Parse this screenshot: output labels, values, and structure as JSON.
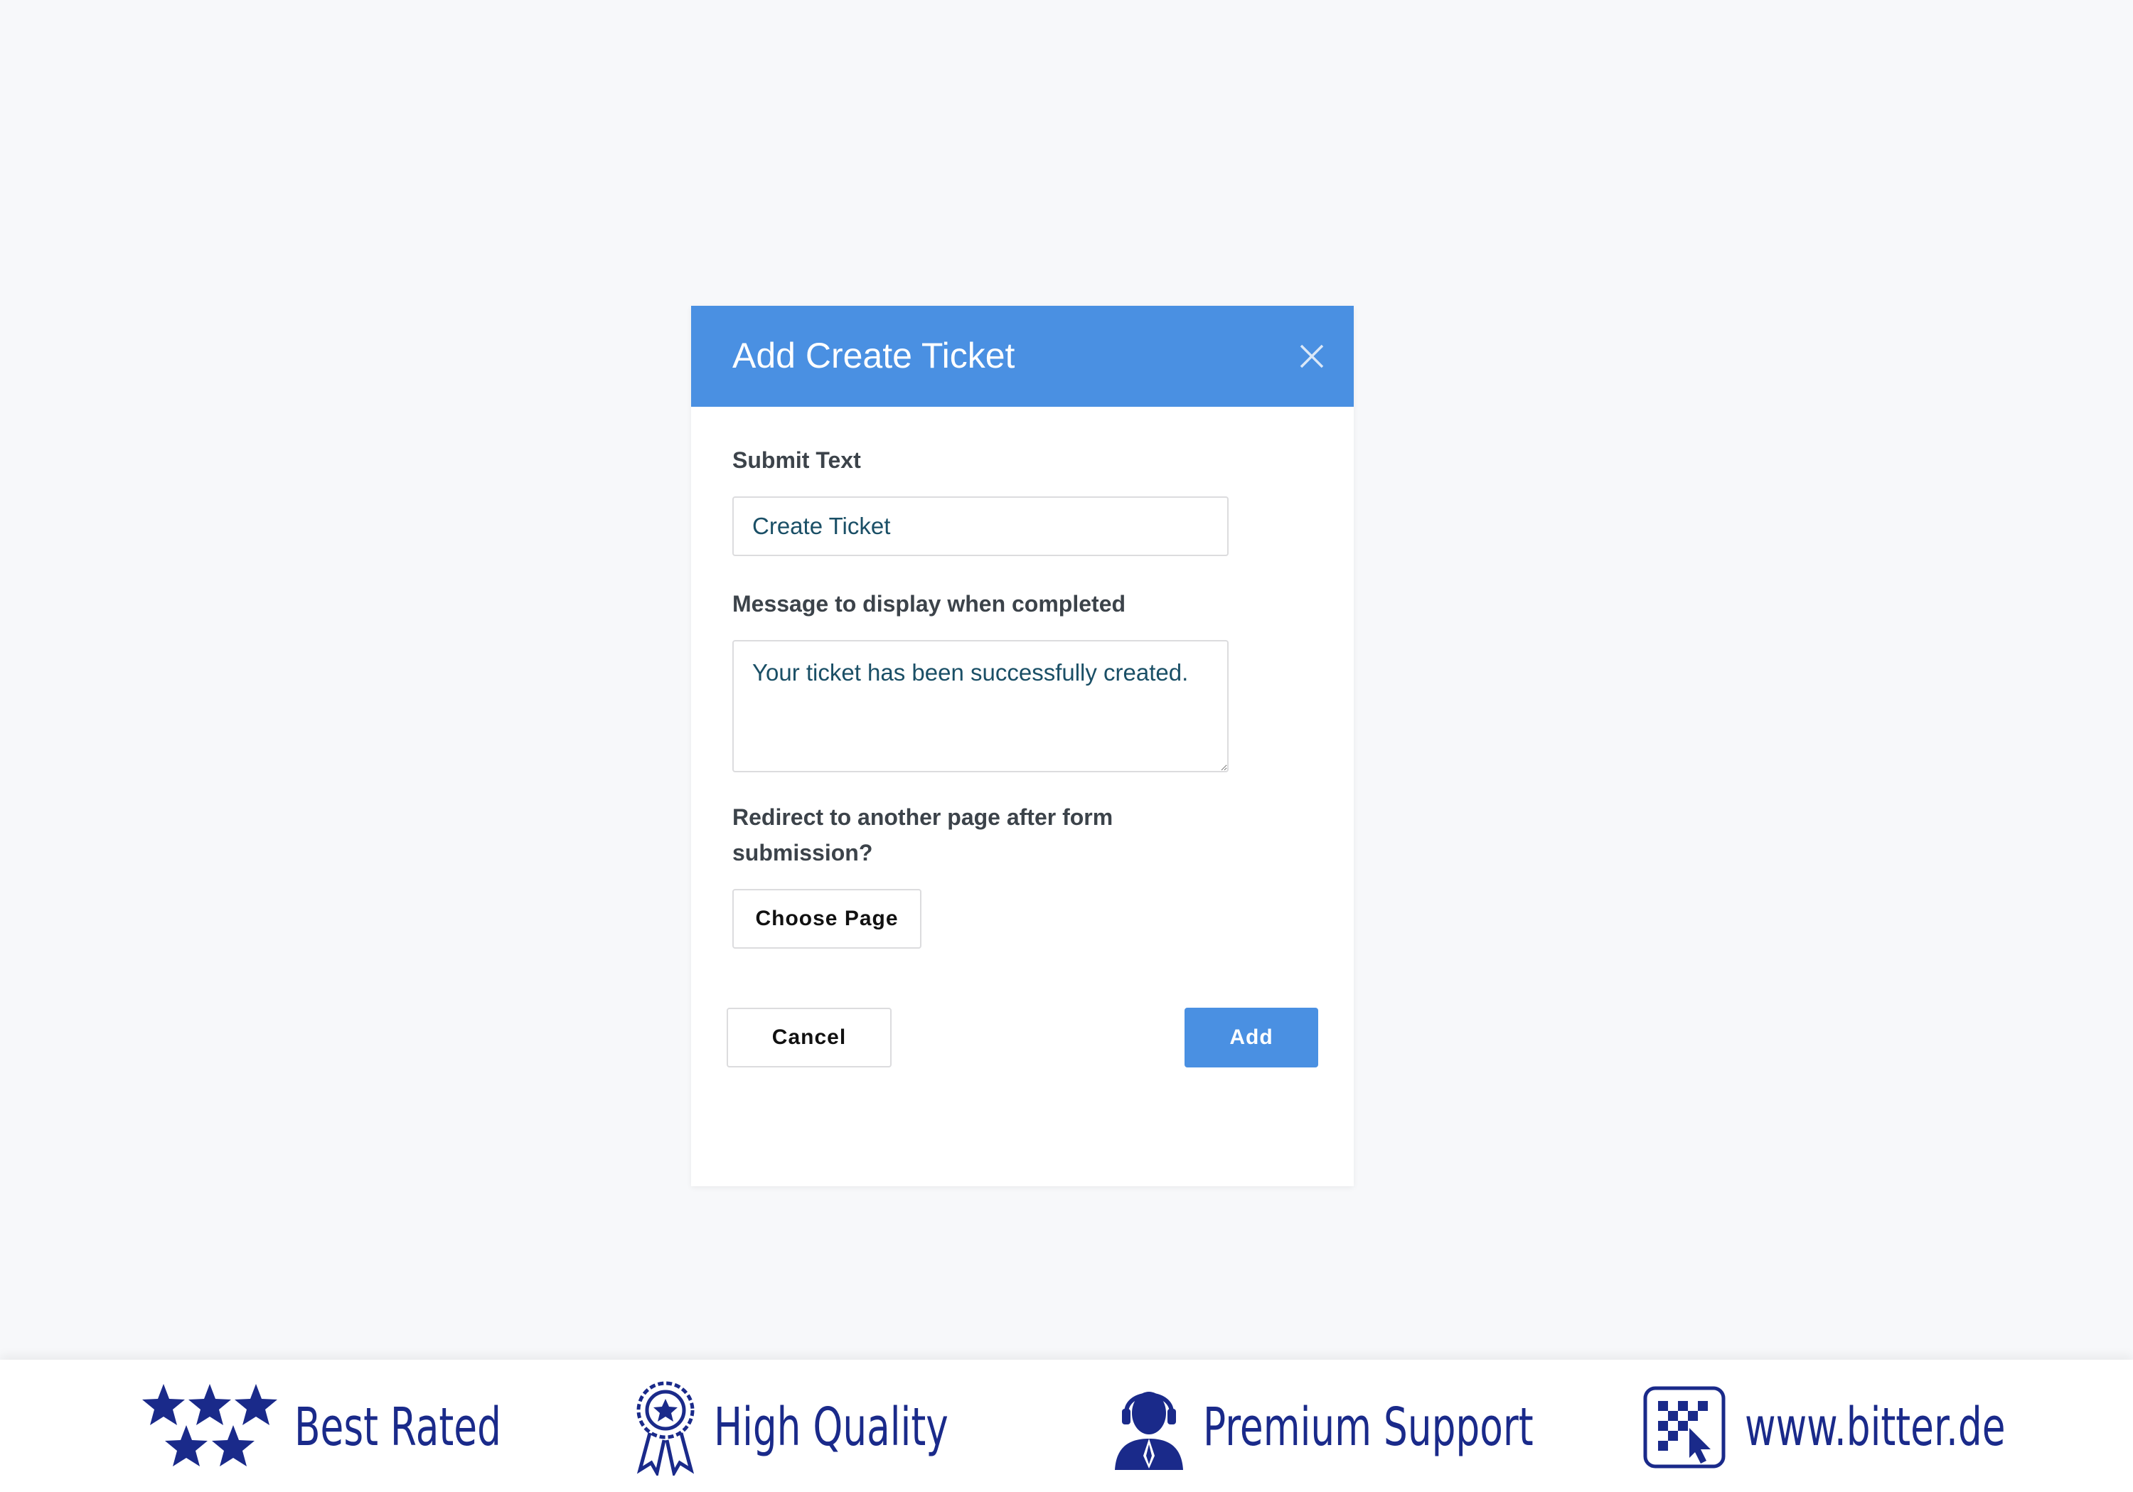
{
  "modal": {
    "title": "Add Create Ticket",
    "close_icon": "close-icon",
    "header_color": "#4a90e2",
    "fields": {
      "submit_text": {
        "label": "Submit Text",
        "value": "Create Ticket"
      },
      "completion_message": {
        "label": "Message to display when completed",
        "value": "Your ticket has been successfully created."
      },
      "redirect": {
        "label_line1": "Redirect to another page after form",
        "label_line2": "submission?",
        "button_label": "Choose Page"
      }
    },
    "buttons": {
      "cancel": "Cancel",
      "add": "Add"
    }
  },
  "footer": {
    "text_color": "#1a2a8a",
    "badges": [
      {
        "icon": "stars-icon",
        "label": "Best Rated"
      },
      {
        "icon": "award-ribbon-icon",
        "label": "High Quality"
      },
      {
        "icon": "support-agent-icon",
        "label": "Premium Support"
      },
      {
        "icon": "bitter-logo-icon",
        "label": "www.bitter.de"
      }
    ]
  }
}
